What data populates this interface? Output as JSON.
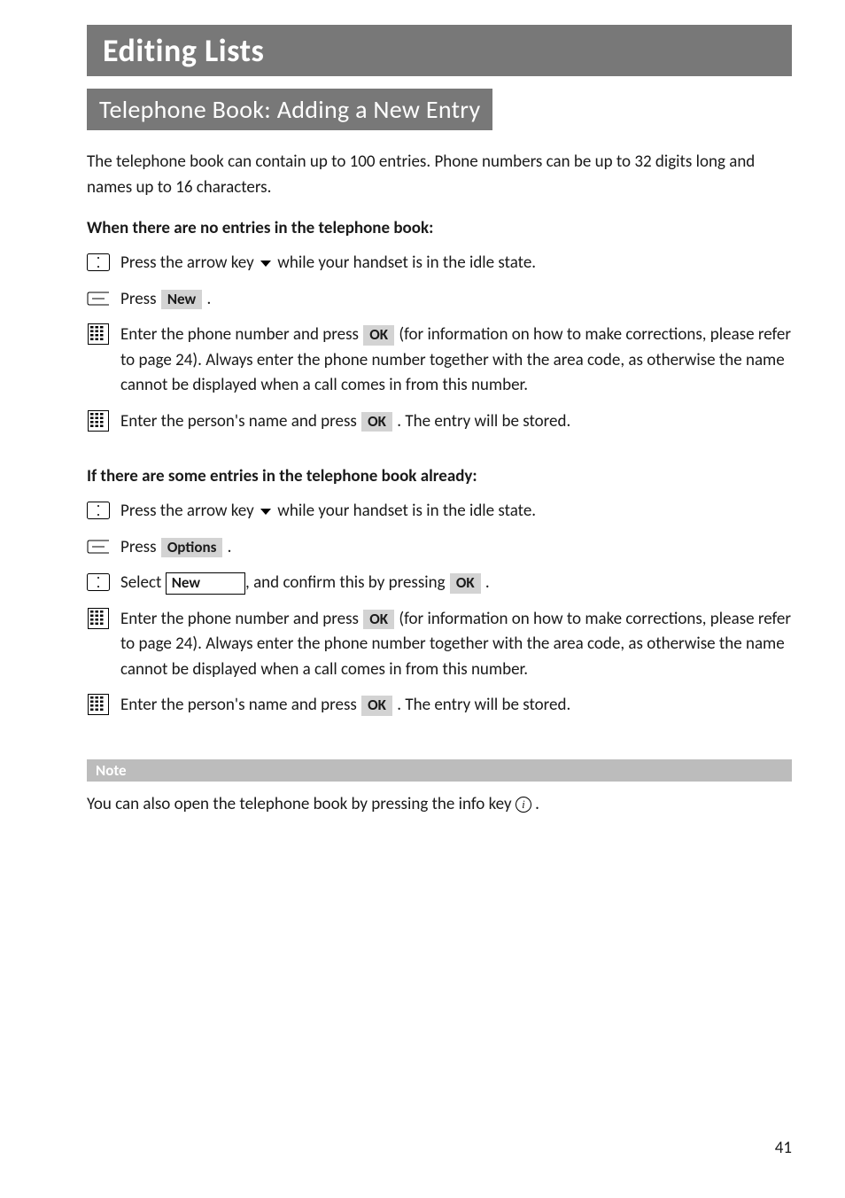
{
  "headings": {
    "main": "Editing Lists",
    "sub": "Telephone Book: Adding a New Entry"
  },
  "intro": "The telephone book can contain up to 100 entries. Phone numbers can be up to 32 digits long and names up to 16 characters.",
  "section1": {
    "label": "When there are no entries in the telephone book:",
    "step1_a": "Press the arrow key ",
    "step1_b": " while your handset is in the idle state.",
    "step2_a": "Press ",
    "step2_b": " .",
    "new_label": "New",
    "step3_a": "Enter the phone number and press ",
    "step3_b": " (for information on how to make corrections, please refer to  page 24). Always enter the phone number together with the area code, as otherwise the name cannot be displayed when a call comes in from this number.",
    "ok_label": "OK",
    "step4_a": "Enter the person's name and press ",
    "step4_b": " . The entry will be stored."
  },
  "section2": {
    "label": "If there are some entries in the telephone book already:",
    "step1_a": "Press the arrow key ",
    "step1_b": " while your handset is in the idle state.",
    "step2_a": "Press ",
    "step2_b": " .",
    "options_label": "Options",
    "step3_a": "Select ",
    "step3_b": ", and confirm this by pressing ",
    "step3_c": " .",
    "new_field": "New",
    "ok_label": "OK",
    "step4_a": "Enter the phone number and press ",
    "step4_b": " (for information on how to make corrections, please refer to  page 24). Always enter the phone number together with the area code, as otherwise the name cannot be displayed when a call comes in from this number.",
    "step5_a": "Enter the person's name and press ",
    "step5_b": " . The entry will be stored."
  },
  "note": {
    "label": "Note",
    "text_a": "You can also open the telephone book by pressing the info key ",
    "text_b": " ."
  },
  "page_number": "41"
}
